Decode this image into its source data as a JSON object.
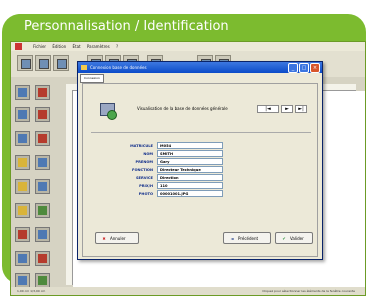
{
  "banner": {
    "title": "Personnalisation / Identification"
  },
  "app": {
    "menu": [
      "Fichier",
      "Édition",
      "État",
      "Paramètres",
      "?"
    ]
  },
  "dialog": {
    "window_title": "Connexion base de données",
    "subtab": "Connexion",
    "heading": "Visualisation de la base de données générale",
    "nav": {
      "prev": "|◄",
      "next": "►",
      "last": "►|"
    },
    "fields": [
      {
        "label": "MATRICULE",
        "value": "M054"
      },
      {
        "label": "NOM",
        "value": "SMITH"
      },
      {
        "label": "PRENOM",
        "value": "Gary"
      },
      {
        "label": "FONCTION",
        "value": "Directeur Technique"
      },
      {
        "label": "SERVICE",
        "value": "Direction"
      },
      {
        "label": "PRIX/H",
        "value": "110"
      },
      {
        "label": "PHOTO",
        "value": "00001001.JPG"
      }
    ],
    "buttons": {
      "cancel": "Annuler",
      "previous": "Précédent",
      "validate": "Valider"
    }
  },
  "status": {
    "left": "1,00 cm   1/3,00 cm",
    "right": "Cliquez pour sélectionner les éléments de la fenêtre courante"
  }
}
